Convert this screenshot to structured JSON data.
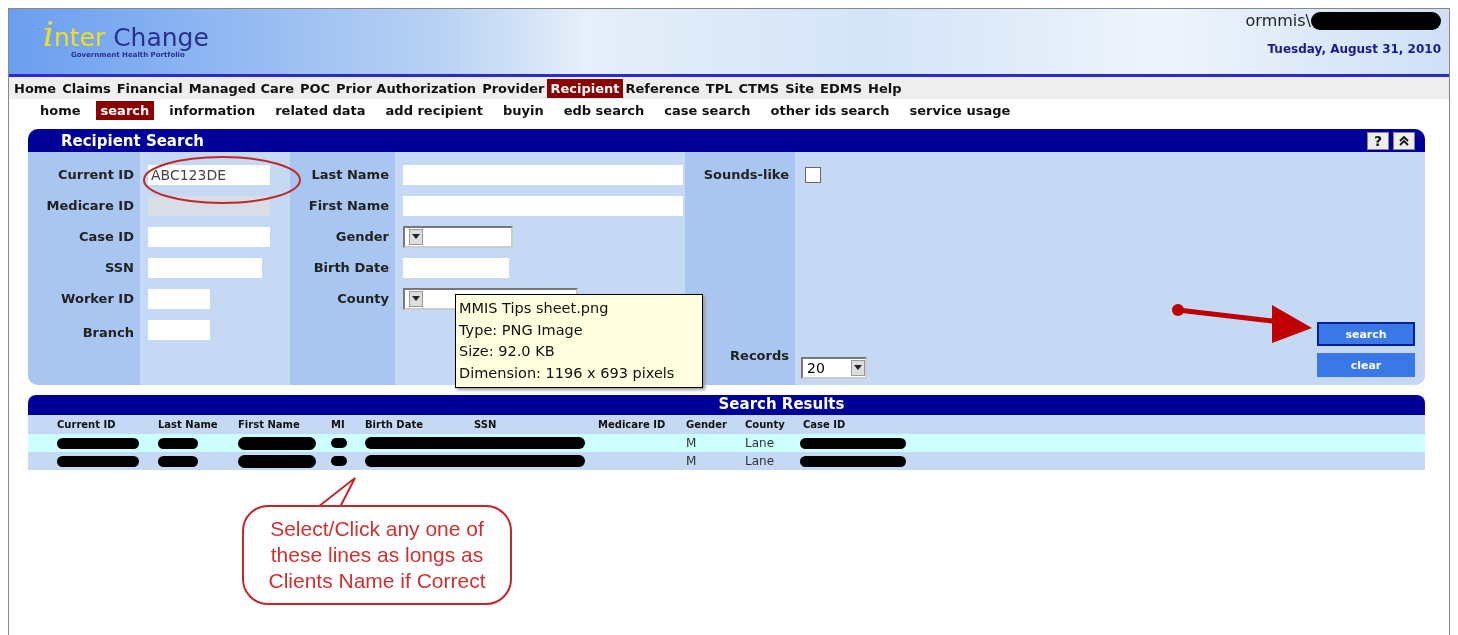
{
  "header": {
    "logo_initial": "i",
    "logo_rest": "nter",
    "logo_word": "Change",
    "tagline": "Government Health Portfolio",
    "user": "ormmis\\",
    "date": "Tuesday, August 31, 2010"
  },
  "menu": [
    {
      "label": "Home",
      "selected": false
    },
    {
      "label": "Claims",
      "selected": false
    },
    {
      "label": "Financial",
      "selected": false
    },
    {
      "label": "Managed Care",
      "selected": false
    },
    {
      "label": "POC",
      "selected": false
    },
    {
      "label": "Prior Authorization",
      "selected": false
    },
    {
      "label": "Provider",
      "selected": false
    },
    {
      "label": "Recipient",
      "selected": true
    },
    {
      "label": "Reference",
      "selected": false
    },
    {
      "label": "TPL",
      "selected": false
    },
    {
      "label": "CTMS",
      "selected": false
    },
    {
      "label": "Site",
      "selected": false
    },
    {
      "label": "EDMS",
      "selected": false
    },
    {
      "label": "Help",
      "selected": false
    }
  ],
  "submenu": [
    {
      "label": "home",
      "selected": false
    },
    {
      "label": "search",
      "selected": true
    },
    {
      "label": "information",
      "selected": false
    },
    {
      "label": "related data",
      "selected": false
    },
    {
      "label": "add recipient",
      "selected": false
    },
    {
      "label": "buyin",
      "selected": false
    },
    {
      "label": "edb search",
      "selected": false
    },
    {
      "label": "case search",
      "selected": false
    },
    {
      "label": "other ids search",
      "selected": false
    },
    {
      "label": "service usage",
      "selected": false
    }
  ],
  "search_panel": {
    "title": "Recipient Search",
    "help": "?",
    "fields_1": [
      {
        "label": "Current ID",
        "kind": "text",
        "value": "ABC123DE"
      },
      {
        "label": "Medicare ID",
        "kind": "text",
        "disabled": true
      },
      {
        "label": "Case ID",
        "kind": "text"
      },
      {
        "label": "SSN",
        "kind": "text"
      },
      {
        "label": "Worker ID",
        "kind": "text"
      },
      {
        "label": "Branch",
        "kind": "text"
      }
    ],
    "fields_2": [
      {
        "label": "Last Name",
        "kind": "text"
      },
      {
        "label": "First Name",
        "kind": "text"
      },
      {
        "label": "Gender",
        "kind": "select"
      },
      {
        "label": "Birth Date",
        "kind": "text"
      },
      {
        "label": "County",
        "kind": "select"
      }
    ],
    "sounds_like": {
      "label": "Sounds-like",
      "checked": false
    },
    "records": {
      "label": "Records",
      "value": "20"
    },
    "buttons": [
      {
        "label": "search",
        "selected": true
      },
      {
        "label": "clear",
        "selected": false
      }
    ]
  },
  "tooltip": [
    "MMIS Tips sheet.png",
    "Type: PNG Image",
    "Size: 92.0 KB",
    "Dimension: 1196 x 693 pixels"
  ],
  "results": {
    "title": "Search Results",
    "columns": [
      "Current ID",
      "Last Name",
      "First Name",
      "MI",
      "Birth Date",
      "SSN",
      "Medicare ID",
      "Gender",
      "County",
      "Case ID"
    ],
    "rows": [
      {
        "gender": "M",
        "county": "Lane"
      },
      {
        "gender": "M",
        "county": "Lane"
      }
    ]
  },
  "callout": "Select/Click any one of these lines as longs as Clients Name if Correct"
}
